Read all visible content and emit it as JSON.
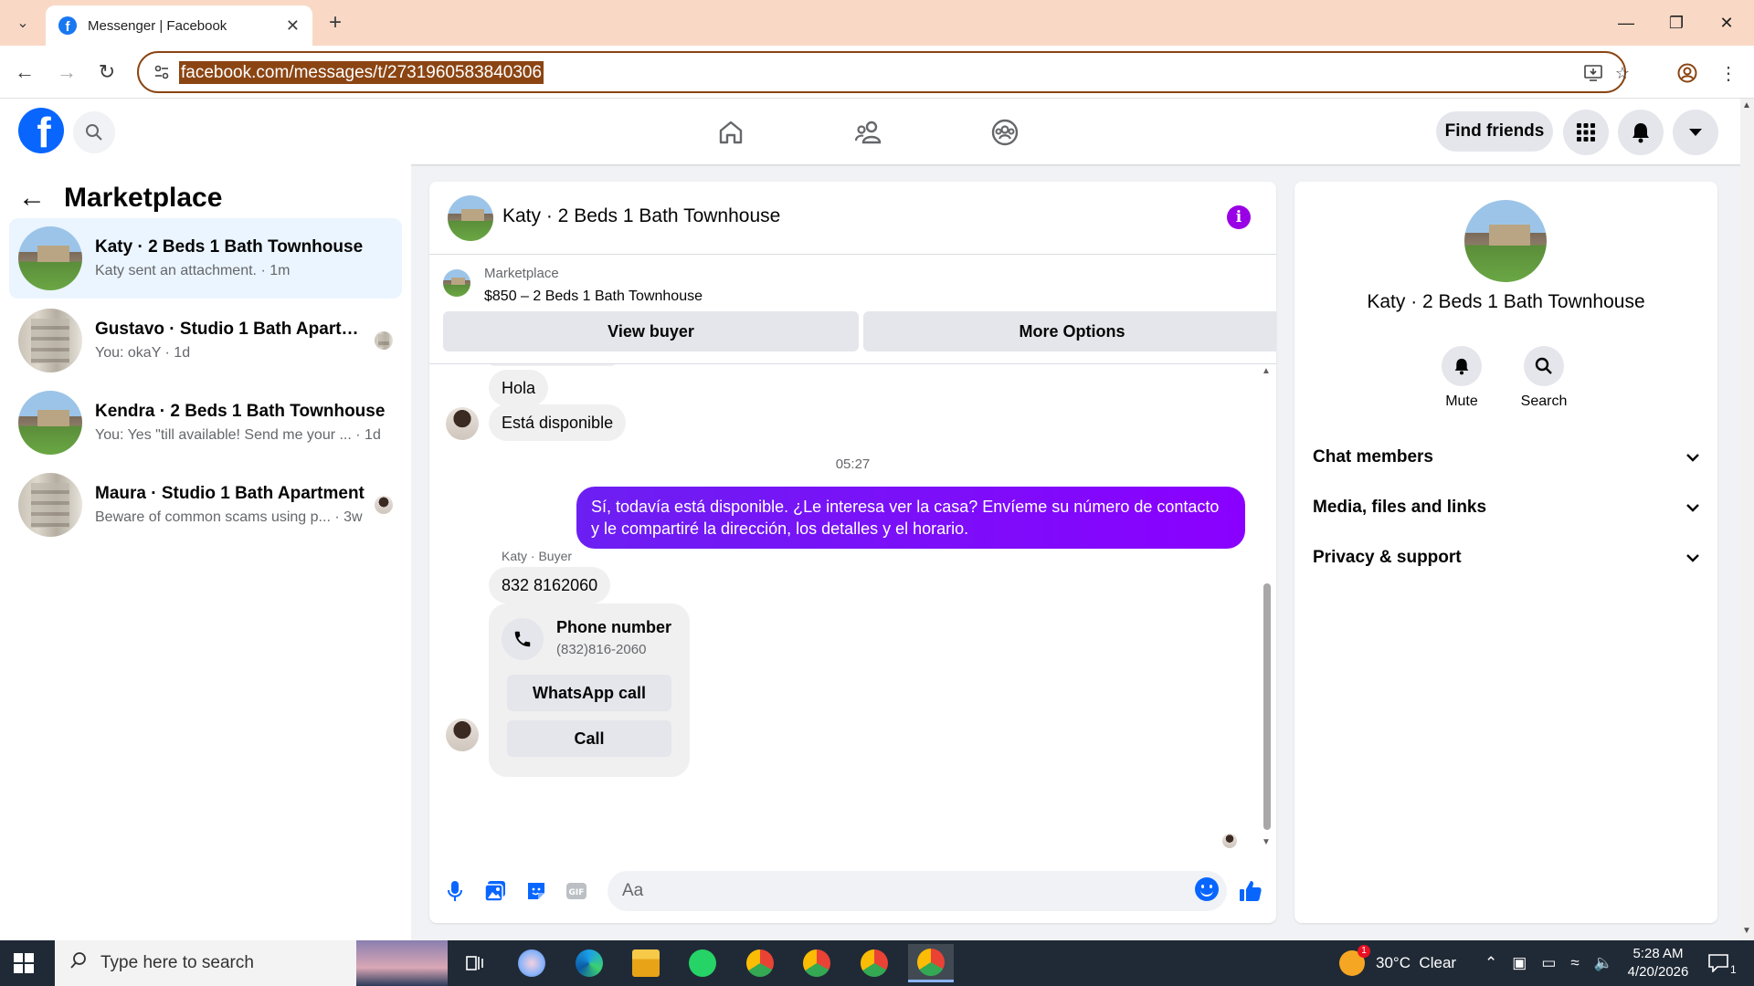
{
  "browser": {
    "tab_title": "Messenger | Facebook",
    "url": "facebook.com/messages/t/2731960583840306"
  },
  "header": {
    "find_friends": "Find friends"
  },
  "sidebar": {
    "title": "Marketplace",
    "conversations": [
      {
        "name": "Katy · 2 Beds 1 Bath Townhouse",
        "preview": "Katy sent an attachment. · 1m",
        "thumb": "house",
        "active": true
      },
      {
        "name": "Gustavo · Studio 1 Bath Apartm...",
        "preview": "You: okaY · 1d",
        "thumb": "apartment"
      },
      {
        "name": "Kendra · 2 Beds 1 Bath Townhouse",
        "preview": "You: Yes \"till available! Send me your ...  · 1d",
        "thumb": "house"
      },
      {
        "name": "Maura · Studio 1 Bath Apartment",
        "preview": "Beware of common scams using p...  · 3w",
        "thumb": "apartment"
      }
    ]
  },
  "chat": {
    "title": "Katy · 2 Beds 1 Bath Townhouse",
    "marketplace_label": "Marketplace",
    "listing": "$850 – 2 Beds 1 Bath Townhouse",
    "view_buyer": "View buyer",
    "more_options": "More Options",
    "messages": {
      "hola": "Hola",
      "disponible": "Está disponible",
      "time": "05:27",
      "reply": "Sí, todavía está disponible. ¿Le interesa ver la casa? Envíeme su número de contacto y le compartiré la dirección, los detalles y el horario.",
      "sender": "Katy · Buyer",
      "phone_text": "832 8162060",
      "card_title": "Phone number",
      "card_number": "(832)816-2060",
      "whatsapp": "WhatsApp call",
      "call": "Call"
    },
    "composer_placeholder": "Aa"
  },
  "info_panel": {
    "name": "Katy · 2 Beds 1 Bath Townhouse",
    "mute": "Mute",
    "search": "Search",
    "sections": [
      "Chat members",
      "Media, files and links",
      "Privacy & support"
    ]
  },
  "taskbar": {
    "search_placeholder": "Type here to search",
    "weather": "30°C  Clear",
    "weather_badge": "1",
    "time": "5:28 AM",
    "date": "4/20/2026",
    "notification_count": "1"
  },
  "colors": {
    "accent": "#0866ff",
    "outgoing_bubble": "#7b00f5",
    "info_icon": "#9900e6",
    "tabbar": "#f9d9c6"
  }
}
